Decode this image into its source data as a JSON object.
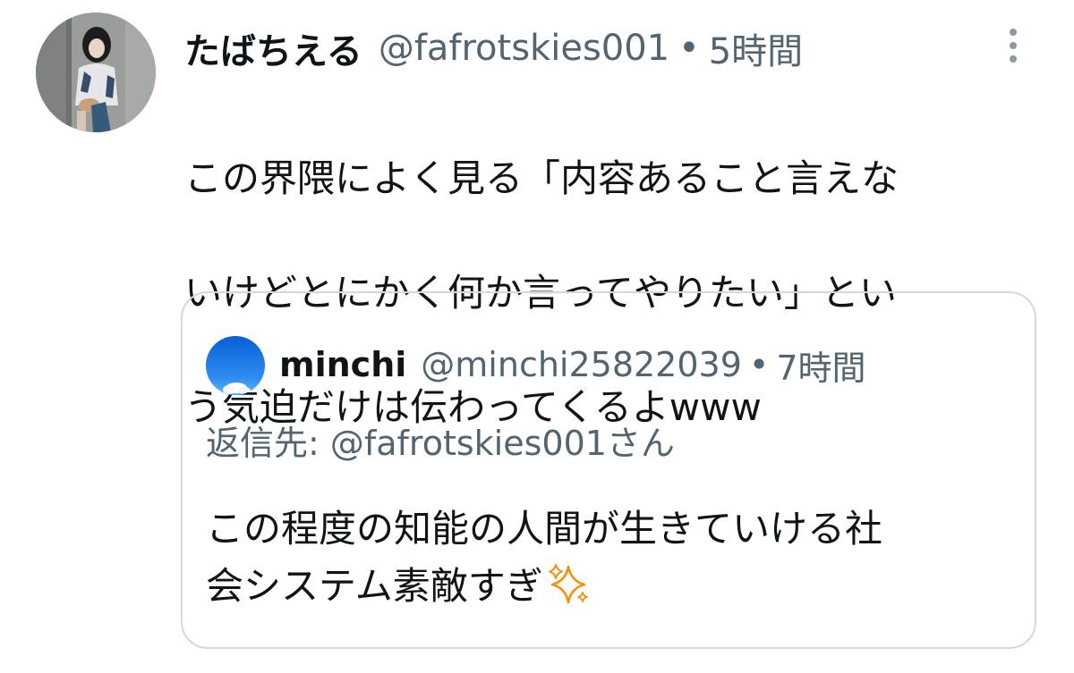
{
  "tweet": {
    "display_name": "たばちえる",
    "handle": "@fafrotskies001",
    "separator": "•",
    "time": "5時間",
    "text_lines": [
      "この界隈によく見る「内容あること言えな",
      "いけどとにかく何か言ってやりたい」とい",
      "う気迫だけは伝わってくるよwww"
    ],
    "more_icon": "more-vertical-icon"
  },
  "quote": {
    "display_name": "minchi",
    "handle": "@minchi25822039",
    "separator": "•",
    "time": "7時間",
    "reply_to": "返信先: @fafrotskies001さん",
    "text_lines": [
      "この程度の知能の人間が生きていける社",
      "会システム素敵すぎ"
    ],
    "emoji_icon": "sparkles-icon",
    "emoji_color": "#f4900c"
  },
  "colors": {
    "text_primary": "#0f1419",
    "text_secondary": "#536471",
    "border": "#cfd9de"
  }
}
